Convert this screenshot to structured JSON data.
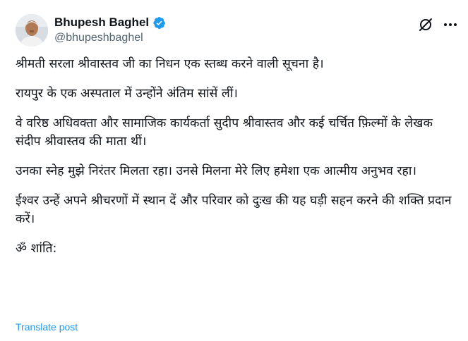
{
  "author": {
    "name": "Bhupesh Baghel",
    "handle": "@bhupeshbaghel",
    "verified": true,
    "verified_color": "#1d9bf0"
  },
  "actions": {
    "grok_icon": "grok-icon",
    "more_icon": "more-options-icon"
  },
  "post": {
    "paragraphs": [
      "श्रीमती सरला श्रीवास्तव जी का निधन एक स्तब्ध करने वाली सूचना है।",
      "रायपुर के एक अस्पताल में उन्होंने अंतिम सांसें लीं।",
      "वे वरिष्ठ अधिवक्ता और सामाजिक कार्यकर्ता सुदीप श्रीवास्तव और कई चर्चित फ़िल्मों के लेखक संदीप श्रीवास्तव की माता थीं।",
      "उनका स्नेह मुझे निरंतर मिलता रहा।  उनसे मिलना मेरे लिए हमेशा एक आत्मीय अनुभव रहा।",
      "ईश्वर उन्हें अपने श्रीचरणों में स्थान दें और परिवार को दुःख की यह घड़ी सहन करने की शक्ति प्रदान करें।",
      "ॐ शांति:"
    ]
  },
  "translate_label": "Translate post",
  "colors": {
    "link": "#1d9bf0",
    "secondary_text": "#536471",
    "text": "#0f1419"
  }
}
